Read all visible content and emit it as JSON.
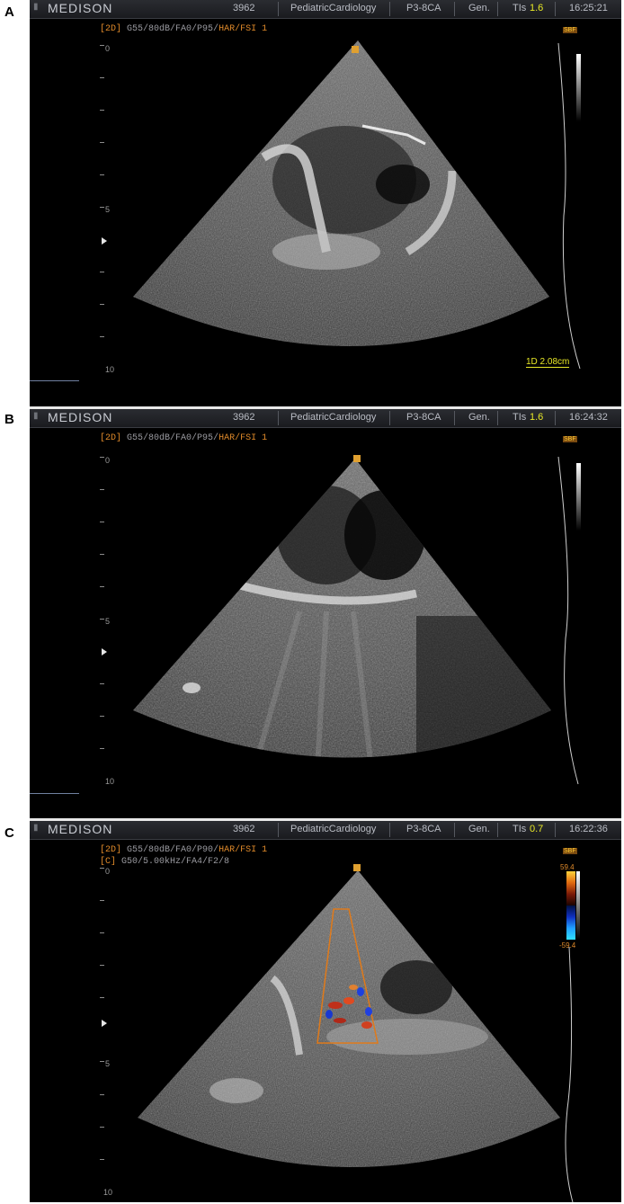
{
  "panels": [
    {
      "label": "A",
      "header": {
        "logo": "MEDISON",
        "code": "3962",
        "app": "PediatricCardiology",
        "probe": "P3-8CA",
        "mode": "Gen.",
        "tis_label": "TIs",
        "tis_value": "1.6",
        "time": "16:25:21"
      },
      "params_2d": {
        "tag": "[2D]",
        "text": "G55/80dB/FA0/P95/",
        "har": "HAR/FSI 1"
      },
      "scale": {
        "top": "0",
        "mid": "5",
        "bottom": "10"
      },
      "measurement": "1D 2.08cm"
    },
    {
      "label": "B",
      "header": {
        "logo": "MEDISON",
        "code": "3962",
        "app": "PediatricCardiology",
        "probe": "P3-8CA",
        "mode": "Gen.",
        "tis_label": "TIs",
        "tis_value": "1.6",
        "time": "16:24:32"
      },
      "params_2d": {
        "tag": "[2D]",
        "text": "G55/80dB/FA0/P95/",
        "har": "HAR/FSI 1"
      },
      "scale": {
        "top": "0",
        "mid": "5",
        "bottom": "10"
      }
    },
    {
      "label": "C",
      "header": {
        "logo": "MEDISON",
        "code": "3962",
        "app": "PediatricCardiology",
        "probe": "P3-8CA",
        "mode": "Gen.",
        "tis_label": "TIs",
        "tis_value": "0.7",
        "time": "16:22:36"
      },
      "params_2d": {
        "tag": "[2D]",
        "text": "G55/80dB/FA0/P90/",
        "har": "HAR/FSI 1"
      },
      "params_c": {
        "tag": "[C]",
        "text": "G50/5.00kHz/FA4/F2/8"
      },
      "scale": {
        "top": "0",
        "mid": "5",
        "bottom": "10"
      },
      "color_scale": {
        "max": "59.4",
        "min": "-59.4"
      }
    }
  ],
  "icons": {
    "focus": "focus-marker-icon",
    "depth": "depth-marker-icon",
    "sbf": "sbf-badge-icon"
  },
  "colors": {
    "params": "#e08a2a",
    "measurement": "#e8e826",
    "background": "#000000"
  }
}
